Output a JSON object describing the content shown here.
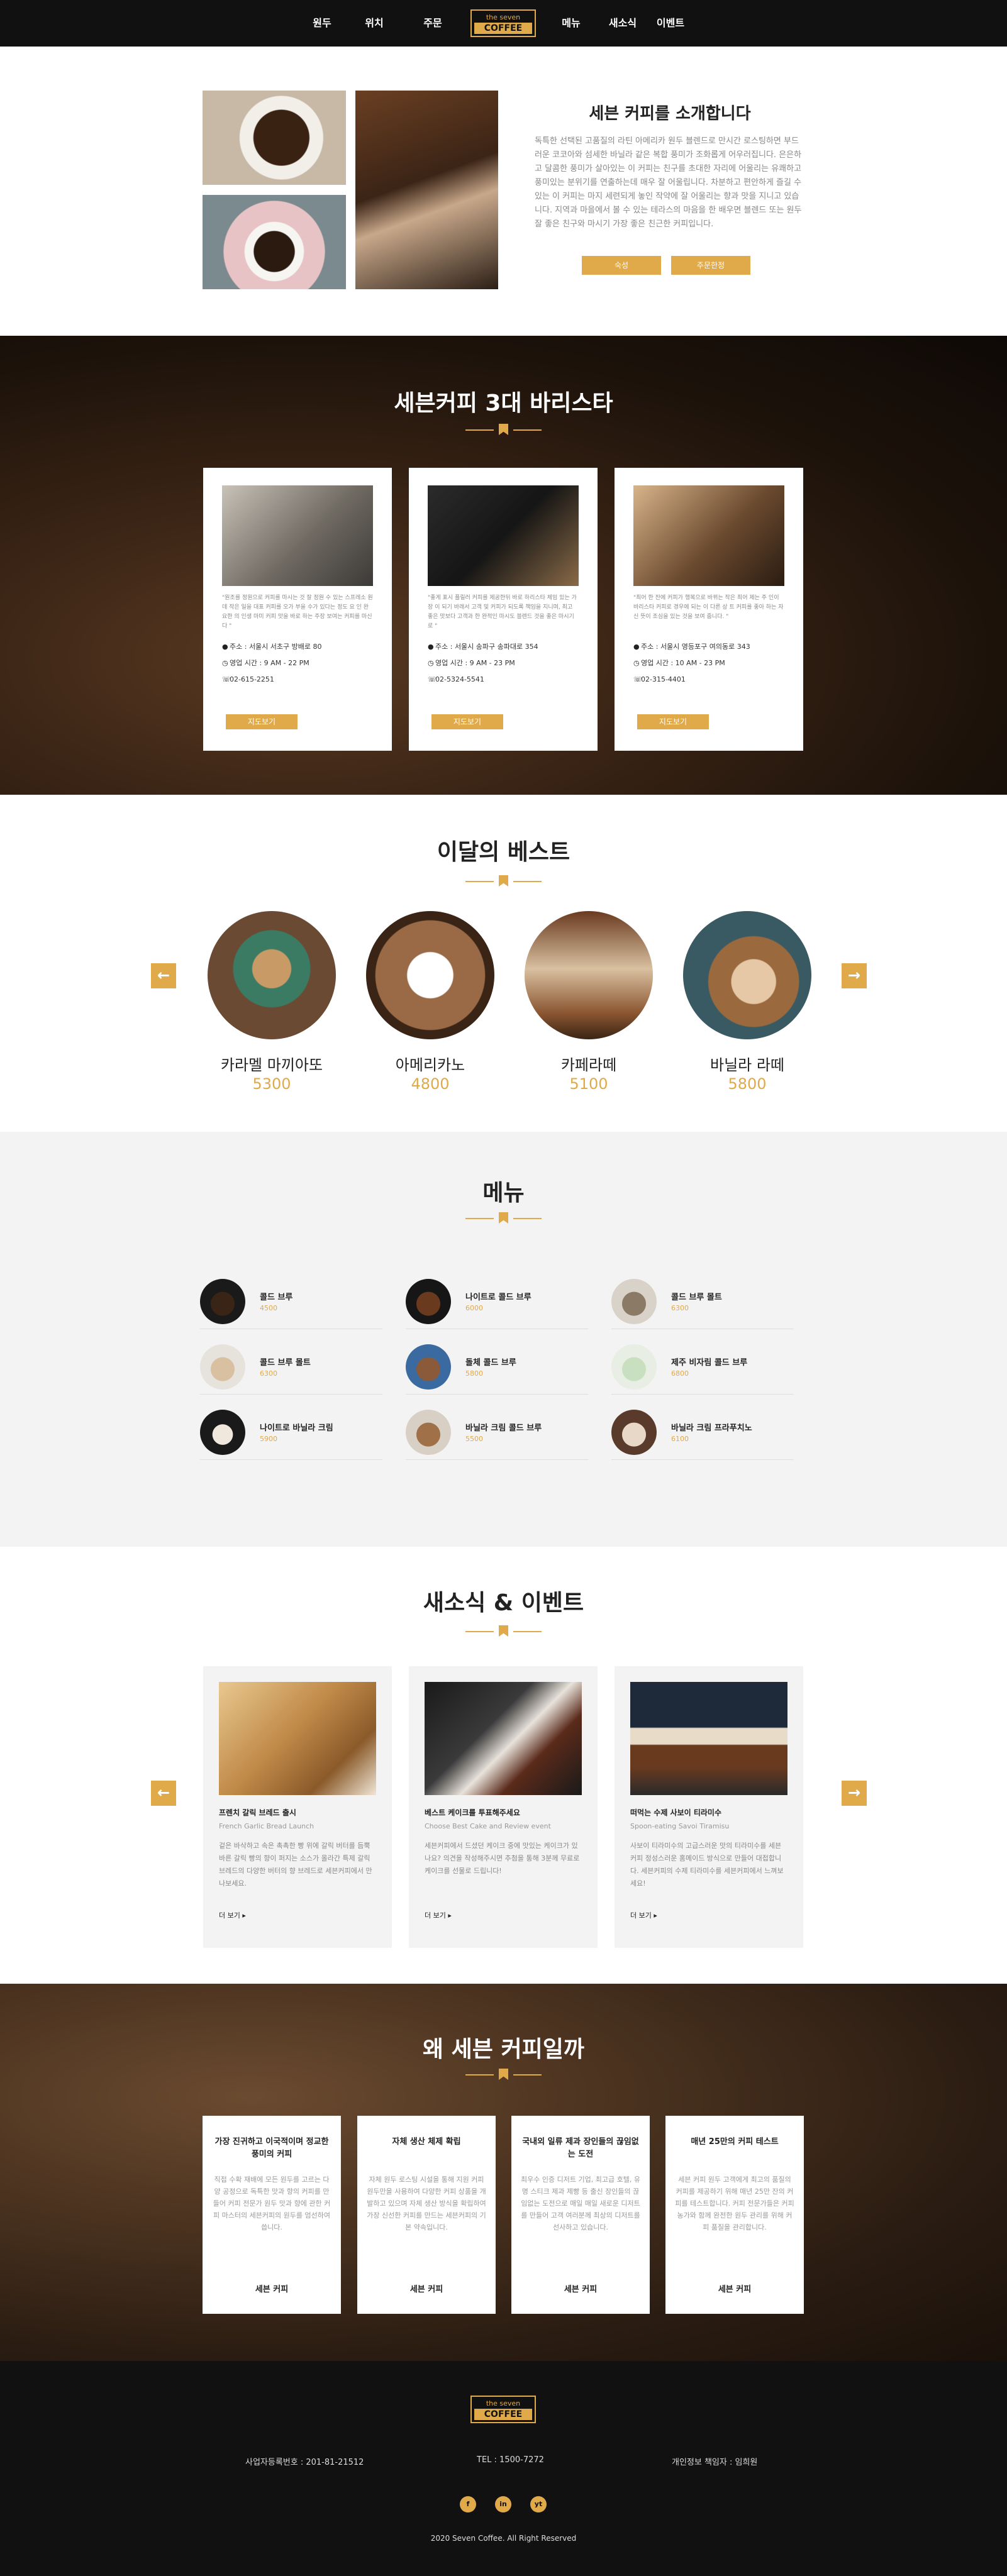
{
  "nav": {
    "items": [
      "원두",
      "위치",
      "주문",
      "메뉴",
      "새소식",
      "이벤트"
    ],
    "logo_top": "the seven",
    "logo_bottom": "COFFEE"
  },
  "intro": {
    "title": "세븐 커피를 소개합니다",
    "text": "독특한 선택된 고품질의 라틴 아메리카 원두 블렌드로 만시간 로스팅하면 부드러운 코코아와 섬세한 바닐라 같은 복합 풍미가 조화롭게 어우러집니다. 은은하고 달콤한 풍미가 살아있는 이 커피는 친구를 초대한 자리에 어울리는 유쾌하고 풍미있는 분위기를 연출하는데 매우 잘 어울립니다. 차분하고 편안하게 즐길 수 있는 이 커피는 마지 세련되게 놓인 작약에 잘 어울리는 향과 맛을 지니고 있습니다. 지역과 마을에서 볼 수 있는 테라스의 마음을 한 배우면 블렌드 또는 원두 잘 좋은 친구와 마시기 가장 좋은 친근한 커피입니다.",
    "btn1": "숙성",
    "btn2": "주문한정"
  },
  "baristas": {
    "title": "세븐커피 3대 바리스타",
    "cards": [
      {
        "quote": "\"원조를 정원으로 커피를 마시는 것 잘 정원 수 있는 스프레소 원데 작은 일을 대표 커피를 오가 부을 수가 있다는 정도 요 인 완 요한 의 인생 마미 커피 맛을 바로 하는 주장 보여는 커피를 마신다 \"",
        "addr": "주소 : 서울시 서초구 방배로 80",
        "hours": "영업 시간 : 9 AM - 22 PM",
        "tel": "02-615-2251",
        "btn": "지도보기"
      },
      {
        "quote": "\"좋게 표시 플릴러 커피를 제공한뒤 바로 하리스타 체임 있는 가장 이 되기 바래서 고객 및 커피가 되도록 책임을 지니며, 최고 좋은 맛보다 고객과 한 완적인 마시도 블렌드 것을 좋은 마시기로 \"",
        "addr": "주소 : 서울시 송파구 송파대로 354",
        "hours": "영업 시간 : 9 AM - 23 PM",
        "tel": "02-5324-5541",
        "btn": "지도보기"
      },
      {
        "quote": "\"최어 한 잔에 커피가 행복으로 바뀌는 작은 최어 제는 주 인이 바리스타 커피로 경우에 되는 이 다른 상 트 커피를 좋아 하는 자신 뜻이 조심을 있는 것을 보여 줍니다. \"",
        "addr": "주소 : 서울시 영등포구 여의동로 343",
        "hours": "영업 시간 : 10 AM - 23 PM",
        "tel": "02-315-4401",
        "btn": "지도보기"
      }
    ]
  },
  "best": {
    "title": "이달의 베스트",
    "items": [
      {
        "name": "카라멜 마끼아또",
        "price": "5300"
      },
      {
        "name": "아메리카노",
        "price": "4800"
      },
      {
        "name": "카페라떼",
        "price": "5100"
      },
      {
        "name": "바닐라 라떼",
        "price": "5800"
      }
    ],
    "prev": "←",
    "next": "→"
  },
  "menu": {
    "title": "메뉴",
    "items": [
      {
        "name": "콜드 브루",
        "price": "4500"
      },
      {
        "name": "나이트로 콜드 브루",
        "price": "6000"
      },
      {
        "name": "돌체 콜드 브루",
        "price": "5800"
      },
      {
        "name": "콜드 브루 몰트",
        "price": "6300"
      },
      {
        "name": "돌체 콜드 브루",
        "price": "5800"
      },
      {
        "name": "제주 비자림 콜드 브루",
        "price": "6800"
      },
      {
        "name": "나이트로 바닐라 크림",
        "price": "5900"
      },
      {
        "name": "바닐라 크림 콜드 브루",
        "price": "5500"
      },
      {
        "name": "바닐라 크림 프라푸치노",
        "price": "6100"
      }
    ]
  },
  "news": {
    "title": "새소식 & 이벤트",
    "cards": [
      {
        "title": "프렌치 갈릭 브레드 출시",
        "sub": "French Garlic Bread Launch",
        "desc": "겉은 바삭하고 속은 촉촉한 빵 위에 갈릭 버터를 듬뿍 바른 갈릭 빵의 향이 퍼지는 소스가 올라간 특제 갈릭 브레드의 다양한 버터의 향 브레드로 세븐커피에서 만나보세요.",
        "more": "더 보기"
      },
      {
        "title": "베스트 케이크를 투표해주세요",
        "sub": "Choose Best Cake and Review event",
        "desc": "세븐커피에서 드셨던 케이크 중에 맛있는 케이크가 있나요? 의견을 작성해주시면 추첨을 통해 3분께 무료로 케이크를 선물로 드립니다!",
        "more": "더 보기"
      },
      {
        "title": "떠먹는 수제 사보이 티라미수",
        "sub": "Spoon-eating Savoi Tiramisu",
        "desc": "사보이 티라미수의 고급스러운 맛의 티라미수를 세븐커피 정성스러운 홈메이드 방식으로 만들어 대접합니다. 세븐커피의 수제 티라미수를 세븐커피에서 느껴보세요!",
        "more": "더 보기"
      }
    ],
    "prev": "←",
    "next": "→"
  },
  "why": {
    "title": "왜 세븐 커피일까",
    "cards": [
      {
        "title": "가장 진귀하고 이국적이며 정교한 풍미의 커피",
        "desc": "직접 수확 재배에 모든 원두를 고르는 다양 공정으로 독특한 맛과 향의 커피를 만들어 커피 전문가 원두 맛과 향에 관한 커피 마스터의 세븐커피의 원두를 엄선하여 씁니다.",
        "foot": "세븐 커피"
      },
      {
        "title": "자체 생산 체제 확립",
        "desc": "자체 원두 로스팅 시설을 통해 지원 커피 원두만을 사용하여 다양한 커피 상품을 개발하고 있으며 자체 생산 방식을 확립하여 가장 신선한 커피를 만드는 세븐커피의 기본 약속입니다.",
        "foot": "세븐 커피"
      },
      {
        "title": "국내외 일류 제과 장인들의 끊임없는 도전",
        "desc": "최우수 인증 디저트 기업, 최고급 호텔, 유명 스티크 제과 제빵 등 출신 장인들의 끊임없는 도전으로 매일 매일 새로운 디저트를 만들어 고객 여러분께 최상의 디저트를 선사하고 있습니다.",
        "foot": "세븐 커피"
      },
      {
        "title": "매년 25만의 커피 테스트",
        "desc": "세븐 커피 원두 고객에게 최고의 품질의 커피를 제공하기 위해 매년 25만 잔의 커피를 테스트합니다. 커피 전문가들은 커피 농가와 함께 완전한 원두 관리를 위해 커피 품질을 관리합니다.",
        "foot": "세븐 커피"
      }
    ]
  },
  "footer": {
    "logo_top": "the seven",
    "logo_bottom": "COFFEE",
    "biz": "사업자등록번호 : 201-81-21512",
    "tel": "TEL : 1500-7272",
    "privacy": "개인정보 책임자 : 임희원",
    "social": [
      "f",
      "in",
      "yt"
    ],
    "copy": "2020 Seven Coffee. All Right Reserved"
  },
  "colors": {
    "accent": "#e0a94a",
    "dark": "#111111",
    "gray_bg": "#f3f3f3"
  },
  "icons": [
    "location-icon",
    "clock-icon",
    "phone-icon",
    "bookmark-icon",
    "arrow-left-icon",
    "arrow-right-icon"
  ]
}
